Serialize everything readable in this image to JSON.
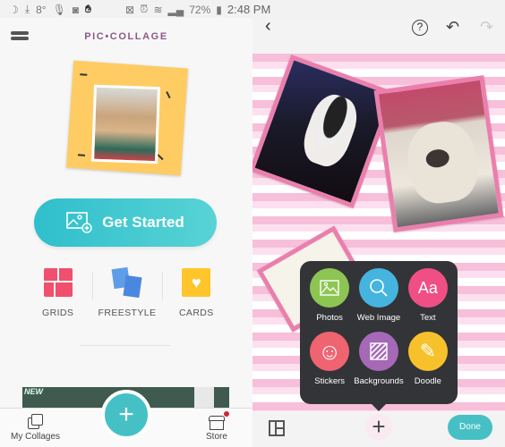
{
  "status_bar": {
    "battery": "72%",
    "time": "2:48 PM",
    "temperature": "8°",
    "icons": [
      "moon-icon",
      "download-icon",
      "mic-icon",
      "camera-icon",
      "hand-icon",
      "mute-icon",
      "alarm-icon",
      "wifi-icon",
      "signal-icon",
      "battery-icon"
    ]
  },
  "left": {
    "logo": "PIC•COLLAGE",
    "get_started": "Get Started",
    "options": [
      {
        "label": "GRIDS",
        "icon": "grid-icon",
        "color": "#f0506e"
      },
      {
        "label": "FREESTYLE",
        "icon": "freestyle-icon",
        "color": "#4a90e2"
      },
      {
        "label": "CARDS",
        "icon": "heart-card-icon",
        "color": "#ffc52a"
      }
    ],
    "banner_text": "NEW",
    "nav": {
      "my_collages": "My Collages",
      "store": "Store",
      "fab": "+"
    },
    "accent": "#45c1c6"
  },
  "right": {
    "toolbar": {
      "back": "‹",
      "help": "?",
      "undo": "↶",
      "redo": "↷"
    },
    "menu": [
      {
        "label": "Photos",
        "color": "#8dc552",
        "icon": "photo-icon"
      },
      {
        "label": "Web Image",
        "color": "#45b4de",
        "icon": "search-icon"
      },
      {
        "label": "Text",
        "color": "#ef4f84",
        "icon": "text-icon",
        "glyph": "Aa"
      },
      {
        "label": "Stickers",
        "color": "#f06371",
        "icon": "smiley-icon",
        "glyph": "☺"
      },
      {
        "label": "Backgrounds",
        "color": "#a569b8",
        "icon": "backgrounds-icon"
      },
      {
        "label": "Doodle",
        "color": "#f6c12a",
        "icon": "pencil-icon",
        "glyph": "✎"
      }
    ],
    "bottom": {
      "add": "+",
      "done": "Done"
    }
  }
}
